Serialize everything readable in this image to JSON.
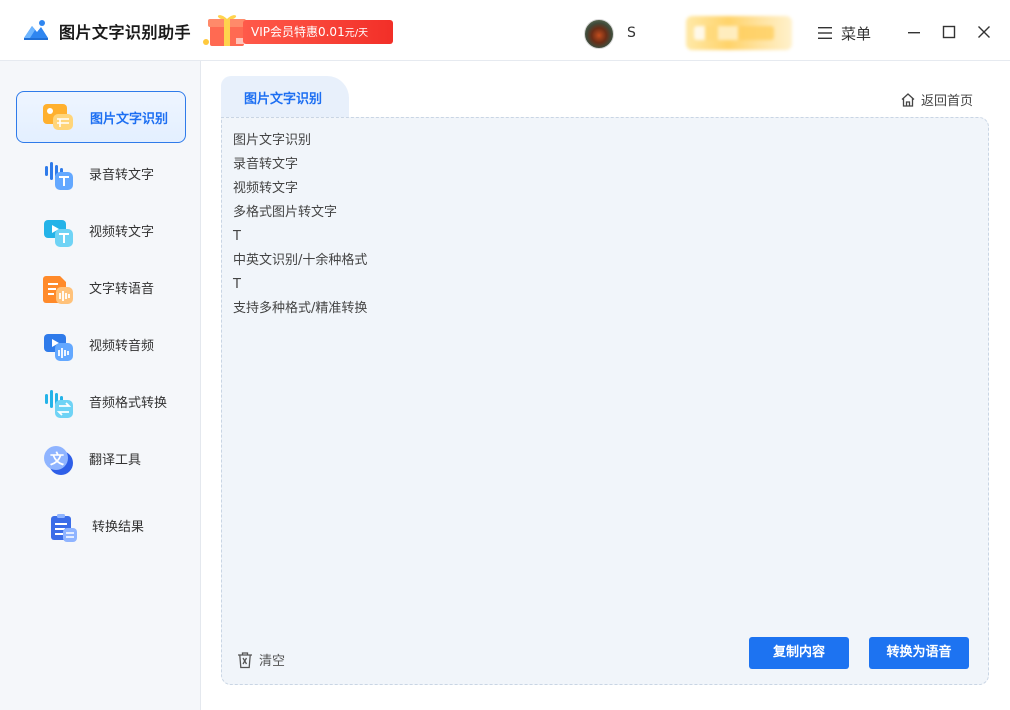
{
  "app": {
    "title": "图片文字识别助手",
    "vip_banner": "VIP会员特惠0.01",
    "vip_unit": "元/天"
  },
  "user": {
    "name": "S"
  },
  "window": {
    "menu_label": "菜单"
  },
  "sidebar": {
    "items": [
      {
        "label": "图片文字识别",
        "icon": "image-text-icon",
        "active": true
      },
      {
        "label": "录音转文字",
        "icon": "audio-to-text-icon",
        "active": false
      },
      {
        "label": "视频转文字",
        "icon": "video-to-text-icon",
        "active": false
      },
      {
        "label": "文字转语音",
        "icon": "text-to-speech-icon",
        "active": false
      },
      {
        "label": "视频转音频",
        "icon": "video-to-audio-icon",
        "active": false
      },
      {
        "label": "音频格式转换",
        "icon": "audio-convert-icon",
        "active": false
      },
      {
        "label": "翻译工具",
        "icon": "translate-icon",
        "active": false
      },
      {
        "label": "转换结果",
        "icon": "results-icon",
        "active": false
      }
    ]
  },
  "main": {
    "tab_label": "图片文字识别",
    "home_link": "返回首页",
    "result_lines": [
      "图片文字识别",
      "录音转文字",
      "视频转文字",
      "多格式图片转文字",
      "T",
      "中英文识别/十余种格式",
      "T",
      "支持多种格式/精准转换"
    ],
    "clear_label": "清空",
    "copy_button": "复制内容",
    "speech_button": "转换为语音"
  },
  "colors": {
    "accent": "#1d73f1",
    "vip": "#f22f28",
    "sidebar_bg": "#f5f7fa",
    "panel_bg": "#f1f5fa"
  }
}
